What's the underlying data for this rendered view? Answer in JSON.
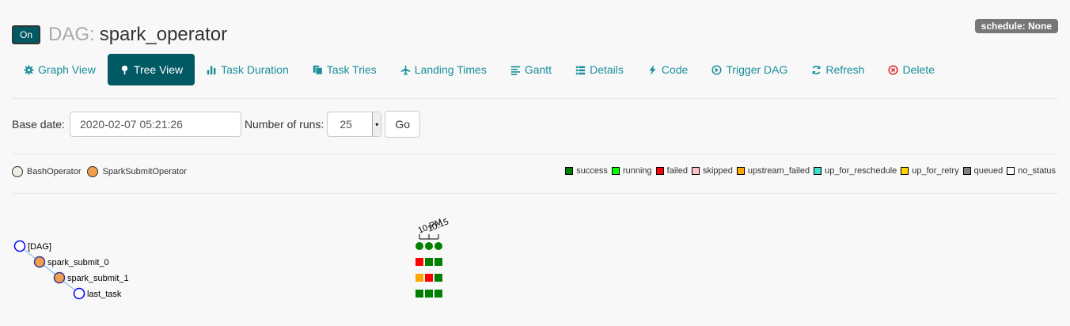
{
  "header": {
    "toggle_label": "On",
    "title_prefix": "DAG:",
    "dag_name": "spark_operator",
    "schedule": "schedule: None"
  },
  "nav": {
    "tabs": [
      {
        "label": "Graph View",
        "icon": "gear-icon",
        "active": false
      },
      {
        "label": "Tree View",
        "icon": "tree-icon",
        "active": true
      },
      {
        "label": "Task Duration",
        "icon": "bar-chart-icon",
        "active": false
      },
      {
        "label": "Task Tries",
        "icon": "files-icon",
        "active": false
      },
      {
        "label": "Landing Times",
        "icon": "plane-icon",
        "active": false
      },
      {
        "label": "Gantt",
        "icon": "align-left-icon",
        "active": false
      },
      {
        "label": "Details",
        "icon": "list-icon",
        "active": false
      },
      {
        "label": "Code",
        "icon": "flash-icon",
        "active": false
      },
      {
        "label": "Trigger DAG",
        "icon": "play-circle-icon",
        "active": false
      },
      {
        "label": "Refresh",
        "icon": "refresh-icon",
        "active": false
      },
      {
        "label": "Delete",
        "icon": "remove-circle-icon",
        "active": false
      }
    ]
  },
  "form": {
    "base_date_label": "Base date:",
    "base_date_value": "2020-02-07 05:21:26",
    "num_runs_label": "Number of runs:",
    "num_runs_value": "25",
    "go_label": "Go"
  },
  "operators": [
    {
      "label": "BashOperator",
      "color": "#f0ede4"
    },
    {
      "label": "SparkSubmitOperator",
      "color": "#f0a04b"
    }
  ],
  "legend": [
    {
      "label": "success",
      "color": "#008000"
    },
    {
      "label": "running",
      "color": "#00ff00"
    },
    {
      "label": "failed",
      "color": "#ff0000"
    },
    {
      "label": "skipped",
      "color": "#ffc0cb"
    },
    {
      "label": "upstream_failed",
      "color": "#ffa500"
    },
    {
      "label": "up_for_reschedule",
      "color": "#40e0d0"
    },
    {
      "label": "up_for_retry",
      "color": "#ffd700"
    },
    {
      "label": "queued",
      "color": "#808080"
    },
    {
      "label": "no_status",
      "color": "#ffffff"
    }
  ],
  "tree": {
    "time_labels": [
      "10 PM",
      "10:15"
    ],
    "nodes": [
      {
        "label": "[DAG]",
        "depth": 0,
        "fill": "#ffffff"
      },
      {
        "label": "spark_submit_0",
        "depth": 1,
        "fill": "#f0a04b"
      },
      {
        "label": "spark_submit_1",
        "depth": 2,
        "fill": "#f0a04b"
      },
      {
        "label": "last_task",
        "depth": 3,
        "fill": "#ffffff"
      }
    ],
    "dag_runs": [
      "success",
      "success",
      "success"
    ],
    "task_states": [
      [
        "failed",
        "success",
        "success"
      ],
      [
        "upstream_failed",
        "failed",
        "success"
      ],
      [
        "success",
        "success",
        "success"
      ]
    ]
  }
}
